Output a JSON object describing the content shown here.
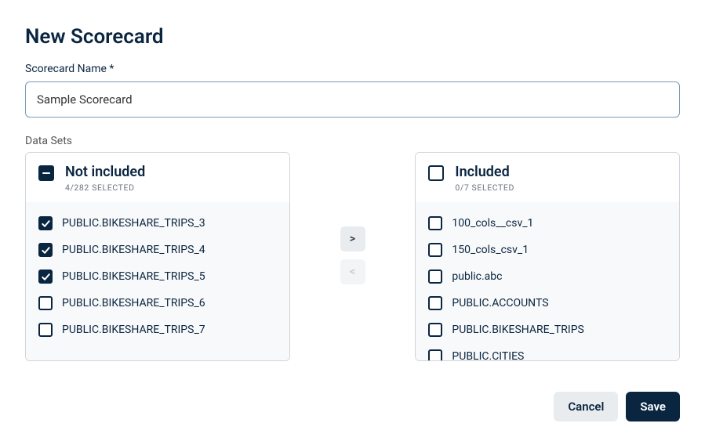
{
  "title": "New Scorecard",
  "nameField": {
    "label": "Scorecard Name *",
    "value": "Sample Scorecard"
  },
  "dataSetsLabel": "Data Sets",
  "notIncluded": {
    "title": "Not included",
    "subtitle": "4/282 SELECTED",
    "headerState": "indeterminate",
    "items": [
      {
        "label": "PUBLIC.BIKESHARE_TRIPS_3",
        "checked": true
      },
      {
        "label": "PUBLIC.BIKESHARE_TRIPS_4",
        "checked": true
      },
      {
        "label": "PUBLIC.BIKESHARE_TRIPS_5",
        "checked": true
      },
      {
        "label": "PUBLIC.BIKESHARE_TRIPS_6",
        "checked": false
      },
      {
        "label": "PUBLIC.BIKESHARE_TRIPS_7",
        "checked": false
      }
    ]
  },
  "included": {
    "title": "Included",
    "subtitle": "0/7 SELECTED",
    "headerState": "unchecked",
    "items": [
      {
        "label": "100_cols__csv_1",
        "checked": false
      },
      {
        "label": "150_cols_csv_1",
        "checked": false
      },
      {
        "label": "public.abc",
        "checked": false
      },
      {
        "label": "PUBLIC.ACCOUNTS",
        "checked": false
      },
      {
        "label": "PUBLIC.BIKESHARE_TRIPS",
        "checked": false
      },
      {
        "label": "PUBLIC.CITIES",
        "checked": false
      }
    ]
  },
  "transfer": {
    "right": ">",
    "left": "<"
  },
  "buttons": {
    "cancel": "Cancel",
    "save": "Save"
  }
}
